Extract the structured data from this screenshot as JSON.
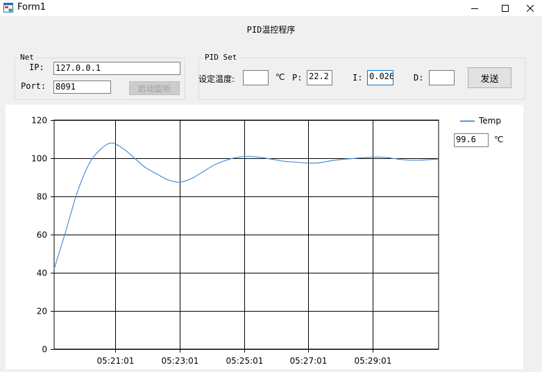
{
  "window": {
    "title": "Form1",
    "controls": {
      "minimize_icon": "minimize-icon",
      "maximize_icon": "maximize-icon",
      "close_icon": "close-icon"
    }
  },
  "heading": "PID温控程序",
  "net": {
    "group_label": "Net",
    "ip_label": "IP:",
    "ip_value": "127.0.0.1",
    "port_label": "Port:",
    "port_value": "8091",
    "start_button": "启动监听"
  },
  "pid": {
    "group_label": "PID Set",
    "set_temp_label": "设定温度:",
    "set_temp_value": "",
    "set_temp_unit": "℃",
    "p_label": "P:",
    "p_value": "22.2",
    "i_label": "I:",
    "i_value": "0.026",
    "d_label": "D:",
    "d_value": "",
    "send_button": "发送"
  },
  "current": {
    "value": "99.6",
    "unit": "℃"
  },
  "colors": {
    "series": "#4a90d9",
    "focus_border": "#0078d7"
  },
  "chart_data": {
    "type": "line",
    "legend": "right-top",
    "grid": true,
    "ylim": [
      0,
      120
    ],
    "y_ticks": [
      "0",
      "20",
      "40",
      "60",
      "80",
      "100",
      "120"
    ],
    "x_ticks": [
      "05:21:01",
      "05:23:01",
      "05:25:01",
      "05:27:01",
      "05:29:01"
    ],
    "xlim": [
      "05:19:07",
      "05:31:04"
    ],
    "series": [
      {
        "name": "Temp",
        "x": [
          "05:19:07",
          "05:19:29",
          "05:19:50",
          "05:20:12",
          "05:20:33",
          "05:20:54",
          "05:21:16",
          "05:21:37",
          "05:21:58",
          "05:22:20",
          "05:22:41",
          "05:23:02",
          "05:23:24",
          "05:23:45",
          "05:24:06",
          "05:24:28",
          "05:24:49",
          "05:25:10",
          "05:25:31",
          "05:25:53",
          "05:26:14",
          "05:26:35",
          "05:26:57",
          "05:27:18",
          "05:27:39",
          "05:28:01",
          "05:28:22",
          "05:28:43",
          "05:29:05",
          "05:29:26",
          "05:29:47",
          "05:30:09",
          "05:30:30",
          "05:31:04"
        ],
        "y": [
          42,
          62,
          82,
          97,
          104.5,
          108,
          105,
          100,
          95,
          91.5,
          88.5,
          87.5,
          89.5,
          93,
          96.5,
          99,
          100.5,
          101,
          100.5,
          99.5,
          98.5,
          98,
          97.5,
          97.5,
          98.5,
          99.3,
          99.8,
          100.3,
          100.6,
          100.4,
          99.6,
          99,
          99,
          99.6
        ]
      }
    ]
  }
}
